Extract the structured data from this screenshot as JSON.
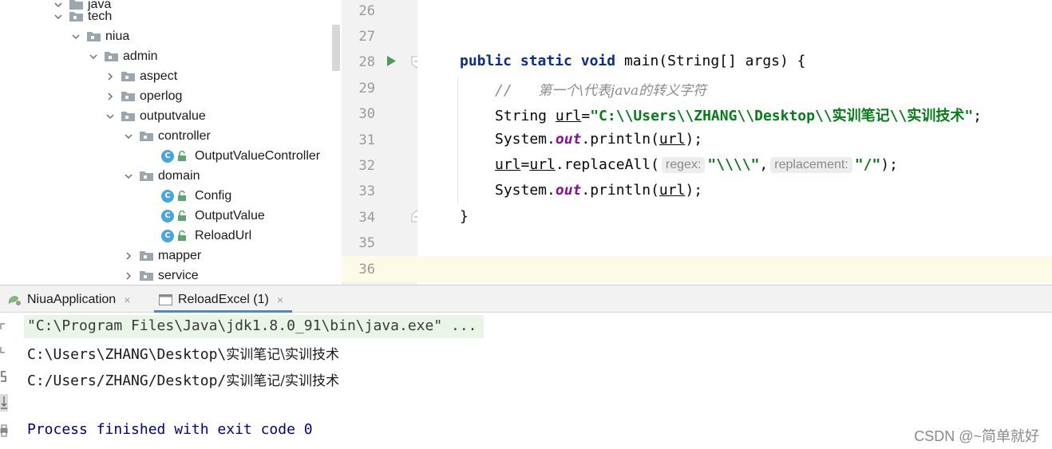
{
  "project_tree": {
    "items": [
      {
        "label": "java",
        "type": "folder"
      },
      {
        "label": "tech",
        "type": "folder"
      },
      {
        "label": "niua",
        "type": "folder"
      },
      {
        "label": "admin",
        "type": "folder"
      },
      {
        "label": "aspect",
        "type": "folder"
      },
      {
        "label": "operlog",
        "type": "folder"
      },
      {
        "label": "outputvalue",
        "type": "folder"
      },
      {
        "label": "controller",
        "type": "folder"
      },
      {
        "label": "OutputValueController",
        "type": "class",
        "badge": "C"
      },
      {
        "label": "domain",
        "type": "folder"
      },
      {
        "label": "Config",
        "type": "class",
        "badge": "C"
      },
      {
        "label": "OutputValue",
        "type": "class",
        "badge": "C"
      },
      {
        "label": "ReloadUrl",
        "type": "class",
        "badge": "C"
      },
      {
        "label": "mapper",
        "type": "folder"
      },
      {
        "label": "service",
        "type": "folder"
      }
    ]
  },
  "editor": {
    "line_numbers": [
      "26",
      "27",
      "28",
      "29",
      "30",
      "31",
      "32",
      "33",
      "34",
      "35",
      "36"
    ],
    "code": {
      "l28": {
        "kw1": "public",
        "kw2": "static",
        "kw3": "void",
        "rest": " main(String[] args) {"
      },
      "l29": {
        "slashes": "//",
        "text": "第一个\\代表java的转义字符"
      },
      "l30": {
        "type": "String ",
        "var": "url",
        "eq": "=",
        "str": "\"C:\\\\Users\\\\ZHANG\\\\Desktop\\\\实训笔记\\\\实训技术\"",
        "semi": ";"
      },
      "l31": {
        "obj": "System.",
        "field": "out",
        "call": ".println(",
        "var": "url",
        "end": ");"
      },
      "l32": {
        "var1": "url",
        "eq": "=",
        "var2": "url",
        "call": ".replaceAll(",
        "hint1": "regex:",
        "str1": "\"\\\\\\\\\"",
        "comma": ",",
        "hint2": "replacement:",
        "str2": "\"/\"",
        "end": ");"
      },
      "l33": {
        "obj": "System.",
        "field": "out",
        "call": ".println(",
        "var": "url",
        "end": ");"
      },
      "l34": {
        "brace": "}"
      }
    }
  },
  "run_panel": {
    "tabs": [
      {
        "label": "NiuaApplication",
        "close": "×"
      },
      {
        "label": "ReloadExcel (1)",
        "close": "×"
      }
    ],
    "output": {
      "command": "\"C:\\Program Files\\Java\\jdk1.8.0_91\\bin\\java.exe\" ...",
      "line1_ascii": "C:\\Users\\ZHANG\\Desktop\\",
      "line1_cjk": "实训笔记\\实训技术",
      "line2_ascii": "C:/Users/ZHANG/Desktop/",
      "line2_cjk": "实训笔记/实训技术",
      "exit": "Process finished with exit code 0"
    }
  },
  "watermark": "CSDN @~简单就好",
  "colors": {
    "keyword": "#0a2c8c",
    "string": "#067d17",
    "static_field": "#871094",
    "comment": "#8c8c8c",
    "run_arrow": "#499c54",
    "class_badge": "#47a6e1",
    "folder": "#9aa7b0",
    "exit_text": "#000080"
  }
}
